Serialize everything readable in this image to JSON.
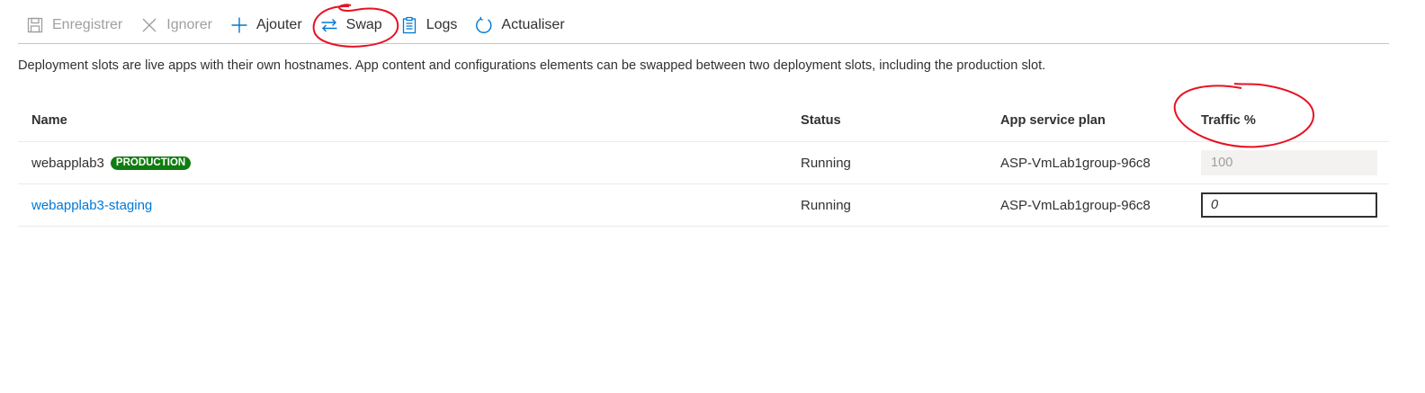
{
  "toolbar": {
    "save": "Enregistrer",
    "discard": "Ignorer",
    "add": "Ajouter",
    "swap": "Swap",
    "logs": "Logs",
    "refresh": "Actualiser"
  },
  "description": "Deployment slots are live apps with their own hostnames. App content and configurations elements can be swapped between two deployment slots, including the production slot.",
  "table": {
    "columns": [
      "Name",
      "Status",
      "App service plan",
      "Traffic %"
    ],
    "rows": [
      {
        "name": "webapplab3",
        "badge": "PRODUCTION",
        "status": "Running",
        "plan": "ASP-VmLab1group-96c8",
        "traffic": "100"
      },
      {
        "name": "webapplab3-staging",
        "status": "Running",
        "plan": "ASP-VmLab1group-96c8",
        "traffic": "0"
      }
    ]
  },
  "colors": {
    "accent": "#0078d4",
    "production_badge": "#107c10",
    "annotation": "#e81123"
  },
  "icons": [
    "save-icon",
    "close-icon",
    "plus-icon",
    "swap-arrows-icon",
    "clipboard-icon",
    "refresh-icon"
  ]
}
